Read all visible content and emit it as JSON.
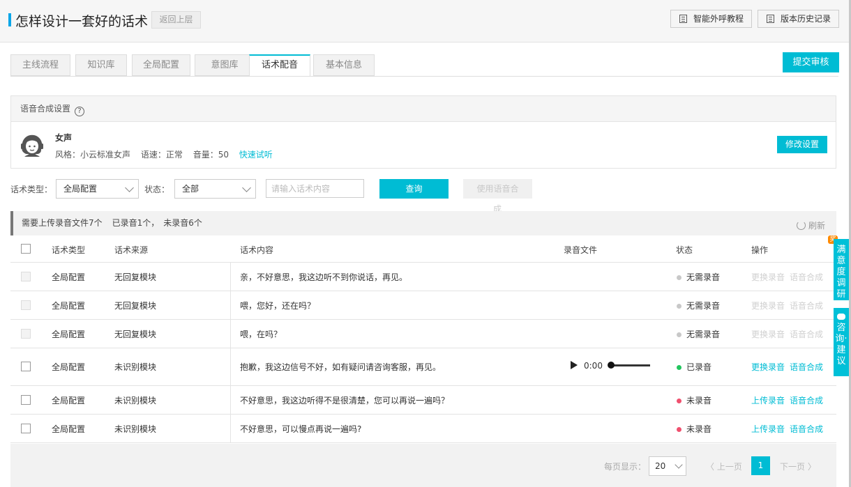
{
  "header": {
    "title": "怎样设计一套好的话术",
    "back_label": "返回上层",
    "tutorial_label": "智能外呼教程",
    "history_label": "版本历史记录"
  },
  "tabs": [
    {
      "label": "主线流程",
      "active": false
    },
    {
      "label": "知识库",
      "active": false
    },
    {
      "label": "全局配置",
      "active": false
    },
    {
      "label": "意图库",
      "active": false
    },
    {
      "label": "话术配音",
      "active": true
    },
    {
      "label": "基本信息",
      "active": false
    }
  ],
  "submit_label": "提交审核",
  "voice_settings": {
    "heading": "语音合成设置",
    "help": "?",
    "voice_name": "女声",
    "style": "风格：小云标准女声",
    "speed": "语速：正常",
    "volume": "音量：50",
    "preview_link": "快速试听",
    "modify_label": "修改设置"
  },
  "filters": {
    "type_label": "话术类型：",
    "type_value": "全局配置",
    "status_label": "状态：",
    "status_value": "全部",
    "search_placeholder": "请输入话术内容",
    "query_label": "查询",
    "synth_label": "使用语音合",
    "synth_label_overflow": "成"
  },
  "summary": {
    "need_upload": "需要上传录音文件7个",
    "recorded": "已录音1个，",
    "unrecorded": "未录音6个",
    "refresh_label": "刷新"
  },
  "table": {
    "columns": [
      "话术类型",
      "话术来源",
      "话术内容",
      "录音文件",
      "状态",
      "操作"
    ],
    "rows": [
      {
        "type": "全局配置",
        "source": "无回复模块",
        "content": "亲，不好意思，我这边听不到你说话，再见。",
        "status": "无需录音",
        "status_color": "#c8c8c8",
        "op1": "更换录音",
        "op2": "语音合成",
        "enabled": false
      },
      {
        "type": "全局配置",
        "source": "无回复模块",
        "content": "喂，您好，还在吗？",
        "status": "无需录音",
        "status_color": "#c8c8c8",
        "op1": "更换录音",
        "op2": "语音合成",
        "enabled": false
      },
      {
        "type": "全局配置",
        "source": "无回复模块",
        "content": "喂，在吗？",
        "status": "无需录音",
        "status_color": "#c8c8c8",
        "op1": "更换录音",
        "op2": "语音合成",
        "enabled": false
      },
      {
        "type": "全局配置",
        "source": "未识别模块",
        "content": "抱歉，我这边信号不好，如有疑问请咨询客服，再见。",
        "audio_time": "0:00",
        "status": "已录音",
        "status_color": "#22c55e",
        "op1": "更换录音",
        "op2": "语音合成",
        "enabled": true
      },
      {
        "type": "全局配置",
        "source": "未识别模块",
        "content": "不好意思，我这边听得不是很清楚，您可以再说一遍吗？",
        "status": "未录音",
        "status_color": "#f0506e",
        "op1": "上传录音",
        "op2": "语音合成",
        "enabled": true
      },
      {
        "type": "全局配置",
        "source": "未识别模块",
        "content": "不好意思，可以慢点再说一遍吗?",
        "status": "未录音",
        "status_color": "#f0506e",
        "op1": "上传录音",
        "op2": "语音合成",
        "enabled": true
      }
    ]
  },
  "pagination": {
    "per_page_label": "每页显示：",
    "per_page_value": "20",
    "prev_label": "上一页",
    "current_page": "1",
    "next_label": "下一页"
  },
  "side_widgets": {
    "survey_label": "满意度调研",
    "survey_badge": "奖",
    "feedback_label": "咨询·建议"
  },
  "colors": {
    "accent": "#00bcd4",
    "recorded": "#22c55e",
    "unrecorded": "#f0506e",
    "not_needed": "#c8c8c8"
  }
}
